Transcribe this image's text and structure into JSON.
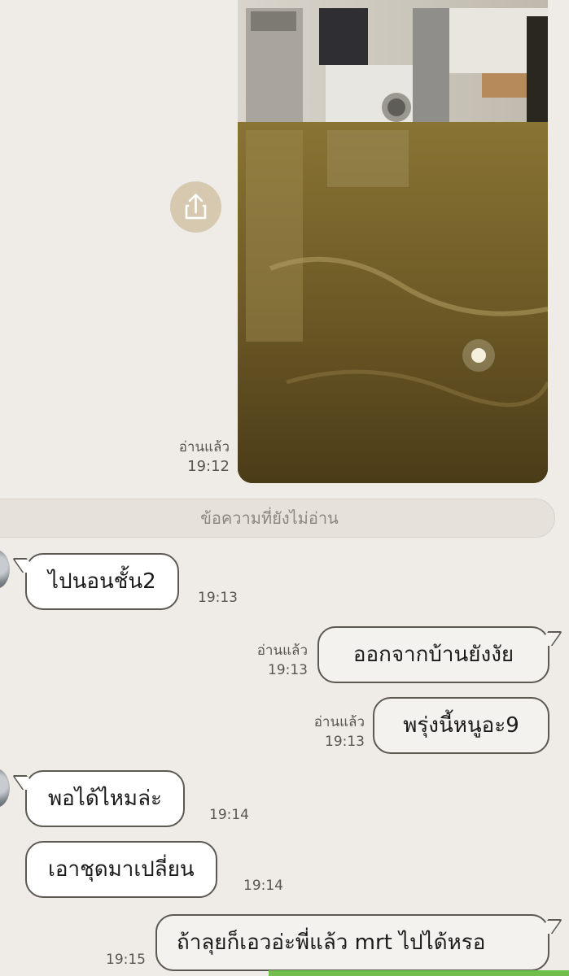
{
  "messages": [
    {
      "id": "m1",
      "type": "image",
      "direction": "out",
      "status": "อ่านแล้ว",
      "time": "19:12",
      "image_desc": "flooded kitchen photo"
    },
    {
      "id": "m2",
      "type": "text",
      "direction": "in",
      "text": "ไปนอนชั้น2",
      "time": "19:13"
    },
    {
      "id": "m3",
      "type": "text",
      "direction": "out",
      "status": "อ่านแล้ว",
      "text": "ออกจากบ้านยังงัย",
      "time": "19:13"
    },
    {
      "id": "m4",
      "type": "text",
      "direction": "out",
      "status": "อ่านแล้ว",
      "text": "พรุ่งนี้หนูอะ9",
      "time": "19:13"
    },
    {
      "id": "m5",
      "type": "text",
      "direction": "in",
      "text": "พอได้ไหมล่ะ",
      "time": "19:14"
    },
    {
      "id": "m6",
      "type": "text",
      "direction": "in",
      "text": "เอาชุดมาเปลี่ยน",
      "time": "19:14"
    },
    {
      "id": "m7",
      "type": "text",
      "direction": "out",
      "text": "ถ้าลุยก็เอวอ่ะพี่แล้ว mrt ไปได้หรอ",
      "time": "19:15"
    }
  ],
  "unread_divider": "ข้อความที่ยังไม่อ่าน",
  "share_icon": "share-icon",
  "colors": {
    "background": "#efebe6",
    "bubble_border": "#5c5852",
    "divider_text": "#8c8780",
    "share_button": "#d7c9b0",
    "bottom_accent": "#6fbf4a"
  }
}
